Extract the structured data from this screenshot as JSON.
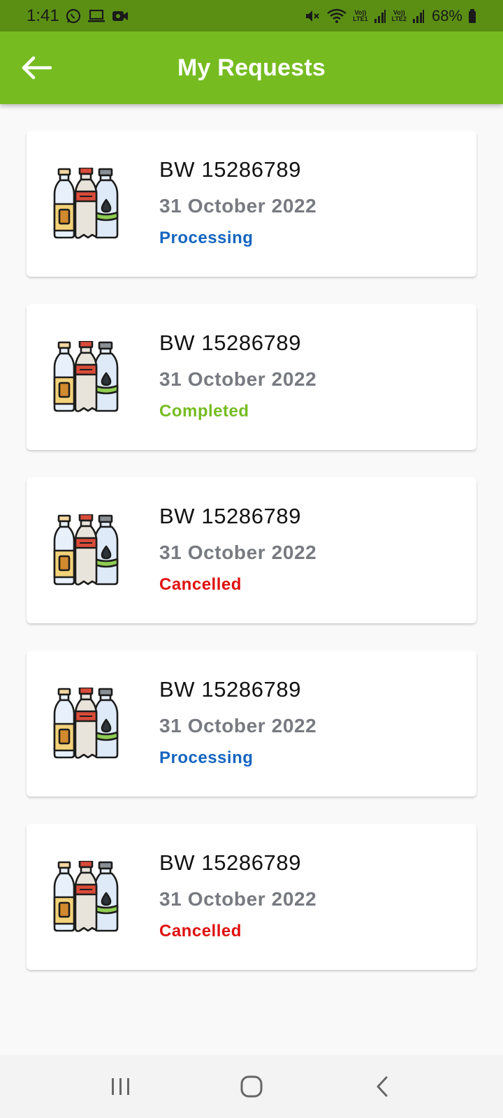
{
  "status_bar": {
    "time": "1:41",
    "sim1_label": "Vo))\nLTE1",
    "sim2_label": "Vo))\nLTE2",
    "battery": "68%"
  },
  "app_bar": {
    "title": "My Requests"
  },
  "colors": {
    "processing": "#1565c0",
    "completed": "#76bc21",
    "cancelled": "#e01010",
    "app_bar": "#76bc21",
    "status_bar": "#5b8f14"
  },
  "requests": [
    {
      "id": "BW 15286789",
      "date": "31 October 2022",
      "status": "Processing",
      "status_key": "processing"
    },
    {
      "id": "BW 15286789",
      "date": "31 October 2022",
      "status": "Completed",
      "status_key": "completed"
    },
    {
      "id": "BW 15286789",
      "date": "31 October 2022",
      "status": "Cancelled",
      "status_key": "cancelled"
    },
    {
      "id": "BW 15286789",
      "date": "31 October 2022",
      "status": "Processing",
      "status_key": "processing"
    },
    {
      "id": "BW 15286789",
      "date": "31 October 2022",
      "status": "Cancelled",
      "status_key": "cancelled"
    }
  ],
  "icons": {
    "card": "bottles-icon",
    "back": "arrow-left-icon",
    "nav_recent": "recent-apps-icon",
    "nav_home": "home-icon",
    "nav_back": "chevron-left-icon"
  }
}
